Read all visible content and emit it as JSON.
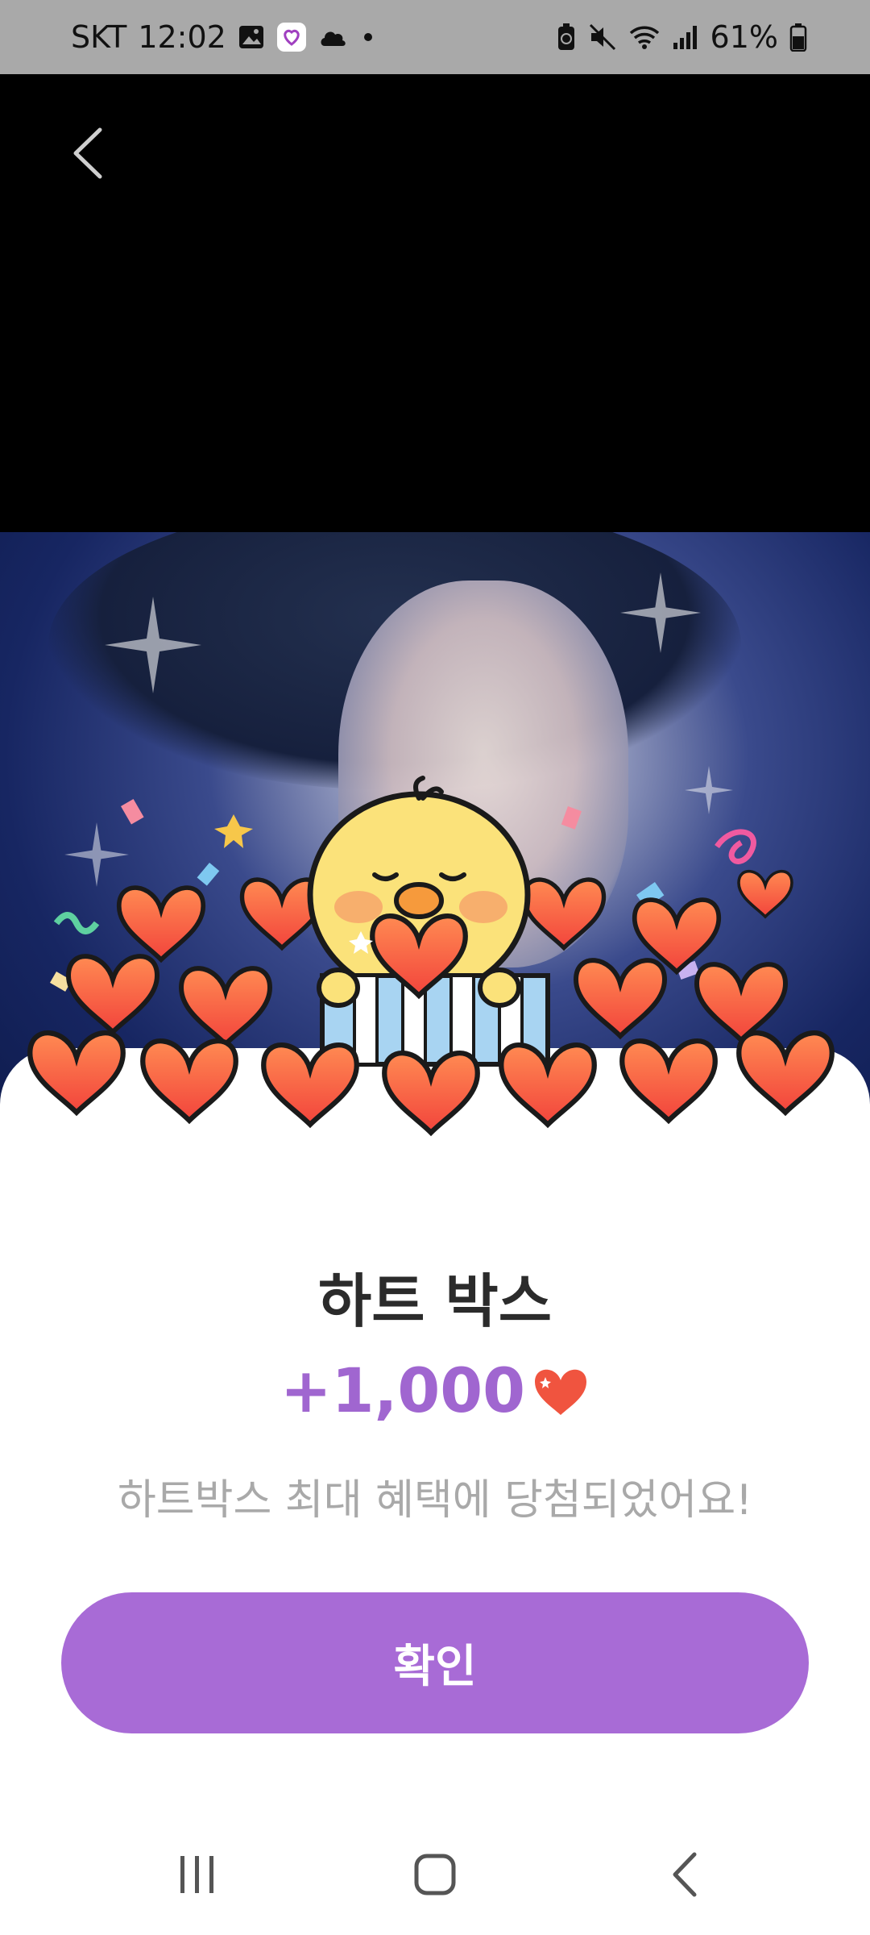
{
  "status_bar": {
    "carrier": "SKT",
    "time": "12:02",
    "battery": "61%",
    "icons": [
      "gallery-icon",
      "app-notification-icon",
      "cloud-icon",
      "dot-icon",
      "battery-saver-icon",
      "mute-icon",
      "wifi-icon",
      "signal-icon",
      "battery-icon"
    ]
  },
  "header": {
    "back_icon": "chevron-left-icon"
  },
  "reward": {
    "title": "하트 박스",
    "amount": "+1,000",
    "amount_icon": "heart-icon",
    "message": "하트박스 최대 혜택에 당첨되었어요!"
  },
  "actions": {
    "confirm_label": "확인"
  },
  "nav_bar": {
    "items": [
      "recent-apps-icon",
      "home-icon",
      "back-icon"
    ]
  },
  "colors": {
    "accent": "#a86bd6",
    "amount": "#a066d0",
    "heart": "#f0543f"
  }
}
